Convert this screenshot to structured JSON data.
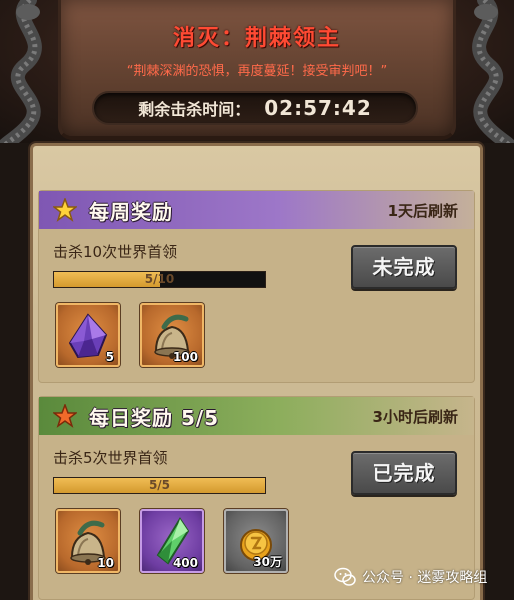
{
  "boss": {
    "title": "消灭：荆棘领主",
    "quote": "“荆棘深渊的恐惧，再度蔓延！接受审判吧！”",
    "timer_label": "剩余击杀时间：",
    "timer_value": "02:57:42"
  },
  "weekly": {
    "title": "每周奖励",
    "refresh": "1天后刷新",
    "task": "击杀10次世界首领",
    "progress_text": "5/10",
    "progress_fraction": 0.5,
    "button_label": "未完成",
    "items": [
      {
        "icon": "purple-crystal-icon",
        "count": "5",
        "rarity": "orange"
      },
      {
        "icon": "bell-horn-icon",
        "count": "100",
        "rarity": "orange"
      }
    ]
  },
  "daily": {
    "title": "每日奖励 5/5",
    "refresh": "3小时后刷新",
    "task": "击杀5次世界首领",
    "progress_text": "5/5",
    "progress_fraction": 1.0,
    "button_label": "已完成",
    "items": [
      {
        "icon": "bell-horn-icon",
        "count": "10",
        "rarity": "orange"
      },
      {
        "icon": "green-crystal-icon",
        "count": "400",
        "rarity": "purple"
      },
      {
        "icon": "gold-coin-icon",
        "count": "30万",
        "rarity": "grey"
      }
    ]
  },
  "watermark": {
    "text": "公众号 · 迷雾攻略组"
  },
  "colors": {
    "boss_title": "#ff4a33",
    "weekly_header": "#7f57b3",
    "daily_header": "#5a8a3c",
    "progress_fill": "#e4ab42"
  }
}
